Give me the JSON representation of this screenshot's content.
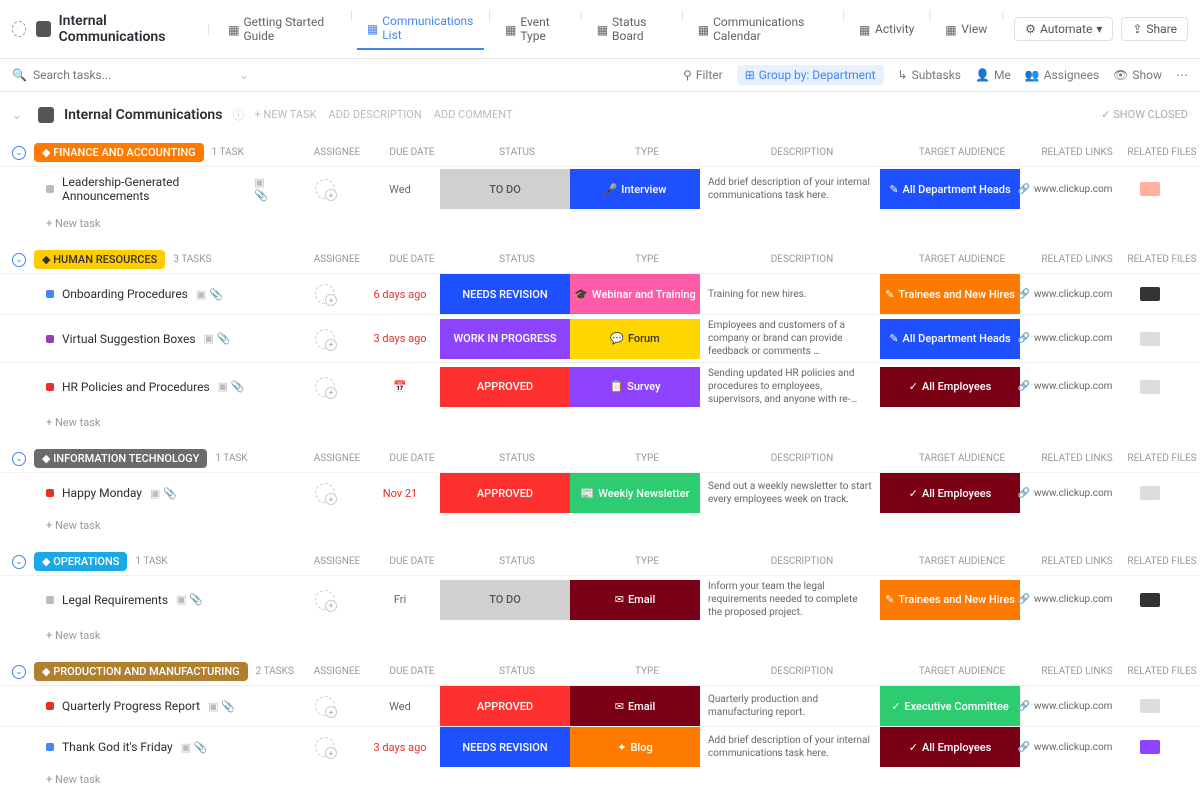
{
  "header": {
    "workspace_title": "Internal Communications",
    "views": [
      {
        "label": "Getting Started Guide",
        "active": false
      },
      {
        "label": "Communications List",
        "active": true
      },
      {
        "label": "Event Type",
        "active": false
      },
      {
        "label": "Status Board",
        "active": false
      },
      {
        "label": "Communications Calendar",
        "active": false
      },
      {
        "label": "Activity",
        "active": false
      },
      {
        "label": "View",
        "active": false
      }
    ],
    "automate": "Automate",
    "share": "Share"
  },
  "toolbar": {
    "search_placeholder": "Search tasks...",
    "filter": "Filter",
    "group_by": "Group by: Department",
    "subtasks": "Subtasks",
    "me": "Me",
    "assignees": "Assignees",
    "show": "Show"
  },
  "list_header": {
    "title": "Internal Communications",
    "new_task": "+ NEW TASK",
    "add_description": "ADD DESCRIPTION",
    "add_comment": "ADD COMMENT",
    "show_closed": "SHOW CLOSED"
  },
  "columns": {
    "assignee": "ASSIGNEE",
    "due_date": "DUE DATE",
    "status": "STATUS",
    "type": "TYPE",
    "description": "DESCRIPTION",
    "target_audience": "TARGET AUDIENCE",
    "related_links": "RELATED LINKS",
    "related_files": "RELATED FILES"
  },
  "new_task_label": "+ New task",
  "groups": [
    {
      "name": "Finance and Accounting",
      "chip_class": "chip-orange",
      "count": "1 TASK",
      "tasks": [
        {
          "name": "Leadership-Generated Announcements",
          "dot": "dot-gray",
          "due": "Wed",
          "due_class": "",
          "status": "TO DO",
          "status_class": "pill-gray",
          "type": "Interview",
          "type_class": "pill-blue",
          "type_icon": "🎤",
          "desc": "Add brief description of your internal communications task here.",
          "audience": "All Department Heads",
          "aud_class": "pill-blue",
          "aud_icon": "✎",
          "link": "www.clickup.com",
          "file_class": "red"
        }
      ]
    },
    {
      "name": "Human Resources",
      "chip_class": "chip-yellow",
      "count": "3 TASKS",
      "tasks": [
        {
          "name": "Onboarding Procedures",
          "dot": "dot-blue",
          "due": "6 days ago",
          "due_class": "due-red",
          "status": "NEEDS REVISION",
          "status_class": "pill-blue",
          "type": "Webinar and Training",
          "type_class": "pill-pink",
          "type_icon": "🎓",
          "desc": "Training for new hires.",
          "audience": "Trainees and New Hires",
          "aud_class": "pill-orange",
          "aud_icon": "✎",
          "link": "www.clickup.com",
          "file_class": "dark"
        },
        {
          "name": "Virtual Suggestion Boxes",
          "dot": "dot-purple",
          "due": "3 days ago",
          "due_class": "due-red",
          "status": "WORK IN PROGRESS",
          "status_class": "pill-purple",
          "type": "Forum",
          "type_class": "pill-yellow",
          "type_icon": "💬",
          "desc": "Employees and customers of a company or brand can provide feedback or comments …",
          "audience": "All Department Heads",
          "aud_class": "pill-blue",
          "aud_icon": "✎",
          "link": "www.clickup.com",
          "file_class": ""
        },
        {
          "name": "HR Policies and Procedures",
          "dot": "dot-red",
          "due": "",
          "due_class": "due-empty",
          "status": "APPROVED",
          "status_class": "pill-red",
          "type": "Survey",
          "type_class": "pill-purple",
          "type_icon": "📋",
          "desc": "Sending updated HR policies and procedures to employees, supervisors, and anyone with re-…",
          "audience": "All Employees",
          "aud_class": "pill-darkred",
          "aud_icon": "✓",
          "link": "www.clickup.com",
          "file_class": ""
        }
      ]
    },
    {
      "name": "Information Technology",
      "chip_class": "chip-gray",
      "count": "1 TASK",
      "tasks": [
        {
          "name": "Happy Monday",
          "dot": "dot-red",
          "due": "Nov 21",
          "due_class": "due-red",
          "status": "APPROVED",
          "status_class": "pill-red",
          "type": "Weekly Newsletter",
          "type_class": "pill-green",
          "type_icon": "📰",
          "desc": "Send out a weekly newsletter to start every employees week on track.",
          "audience": "All Employees",
          "aud_class": "pill-darkred",
          "aud_icon": "✓",
          "link": "www.clickup.com",
          "file_class": ""
        }
      ]
    },
    {
      "name": "Operations",
      "chip_class": "chip-blue",
      "count": "1 TASK",
      "tasks": [
        {
          "name": "Legal Requirements",
          "dot": "dot-gray",
          "due": "Fri",
          "due_class": "",
          "status": "TO DO",
          "status_class": "pill-gray",
          "type": "Email",
          "type_class": "pill-darkred",
          "type_icon": "✉",
          "desc": "Inform your team the legal requirements needed to complete the proposed project.",
          "audience": "Trainees and New Hires",
          "aud_class": "pill-orange",
          "aud_icon": "✎",
          "link": "www.clickup.com",
          "file_class": "dark"
        }
      ]
    },
    {
      "name": "Production and Manufacturing",
      "chip_class": "chip-brown",
      "count": "2 TASKS",
      "tasks": [
        {
          "name": "Quarterly Progress Report",
          "dot": "dot-red",
          "due": "Wed",
          "due_class": "",
          "status": "APPROVED",
          "status_class": "pill-red",
          "type": "Email",
          "type_class": "pill-darkred",
          "type_icon": "✉",
          "desc": "Quarterly production and manufacturing report.",
          "audience": "Executive Committee",
          "aud_class": "pill-green",
          "aud_icon": "✓",
          "link": "www.clickup.com",
          "file_class": ""
        },
        {
          "name": "Thank God it's Friday",
          "dot": "dot-blue",
          "due": "3 days ago",
          "due_class": "due-red",
          "status": "NEEDS REVISION",
          "status_class": "pill-blue",
          "type": "Blog",
          "type_class": "pill-orange",
          "type_icon": "✦",
          "desc": "Add brief description of your internal communications task here.",
          "audience": "All Employees",
          "aud_class": "pill-darkred",
          "aud_icon": "✓",
          "link": "www.clickup.com",
          "file_class": "purple"
        }
      ]
    }
  ]
}
